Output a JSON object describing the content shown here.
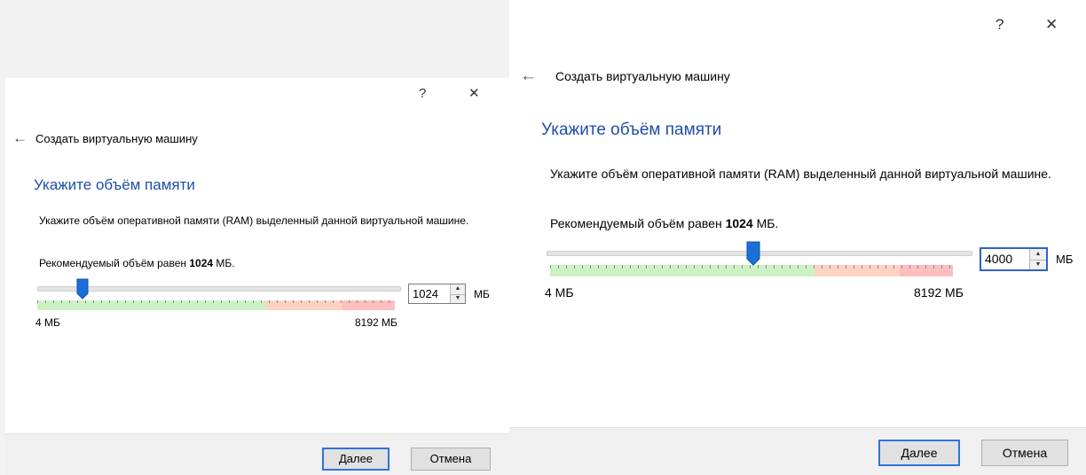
{
  "window_controls": {
    "help_symbol": "?",
    "close_symbol": "✕"
  },
  "back_symbol": "←",
  "wizard_title": "Создать виртуальную машину",
  "page_heading": "Укажите объём памяти",
  "description": "Укажите объём оперативной памяти (RAM) выделенный данной виртуальной машине.",
  "recommended_prefix": "Рекомендуемый объём равен",
  "recommended_value": "1024",
  "recommended_unit": "МБ.",
  "slider": {
    "min_label": "4 МБ",
    "max_label": "8192 МБ",
    "unit": "МБ"
  },
  "panels": [
    {
      "spin_value": "1024",
      "slider_fraction": 0.125
    },
    {
      "spin_value": "4000",
      "slider_fraction": 0.488
    }
  ],
  "buttons": {
    "next_accel": "Д",
    "next_rest": "алее",
    "cancel": "Отмена"
  },
  "colors": {
    "heading": "#1e4fa8",
    "accent": "#2f73d9",
    "green_zone": "#ccf2c4",
    "orange_zone": "#ffd3c2",
    "red_zone": "#fdbfbf"
  }
}
